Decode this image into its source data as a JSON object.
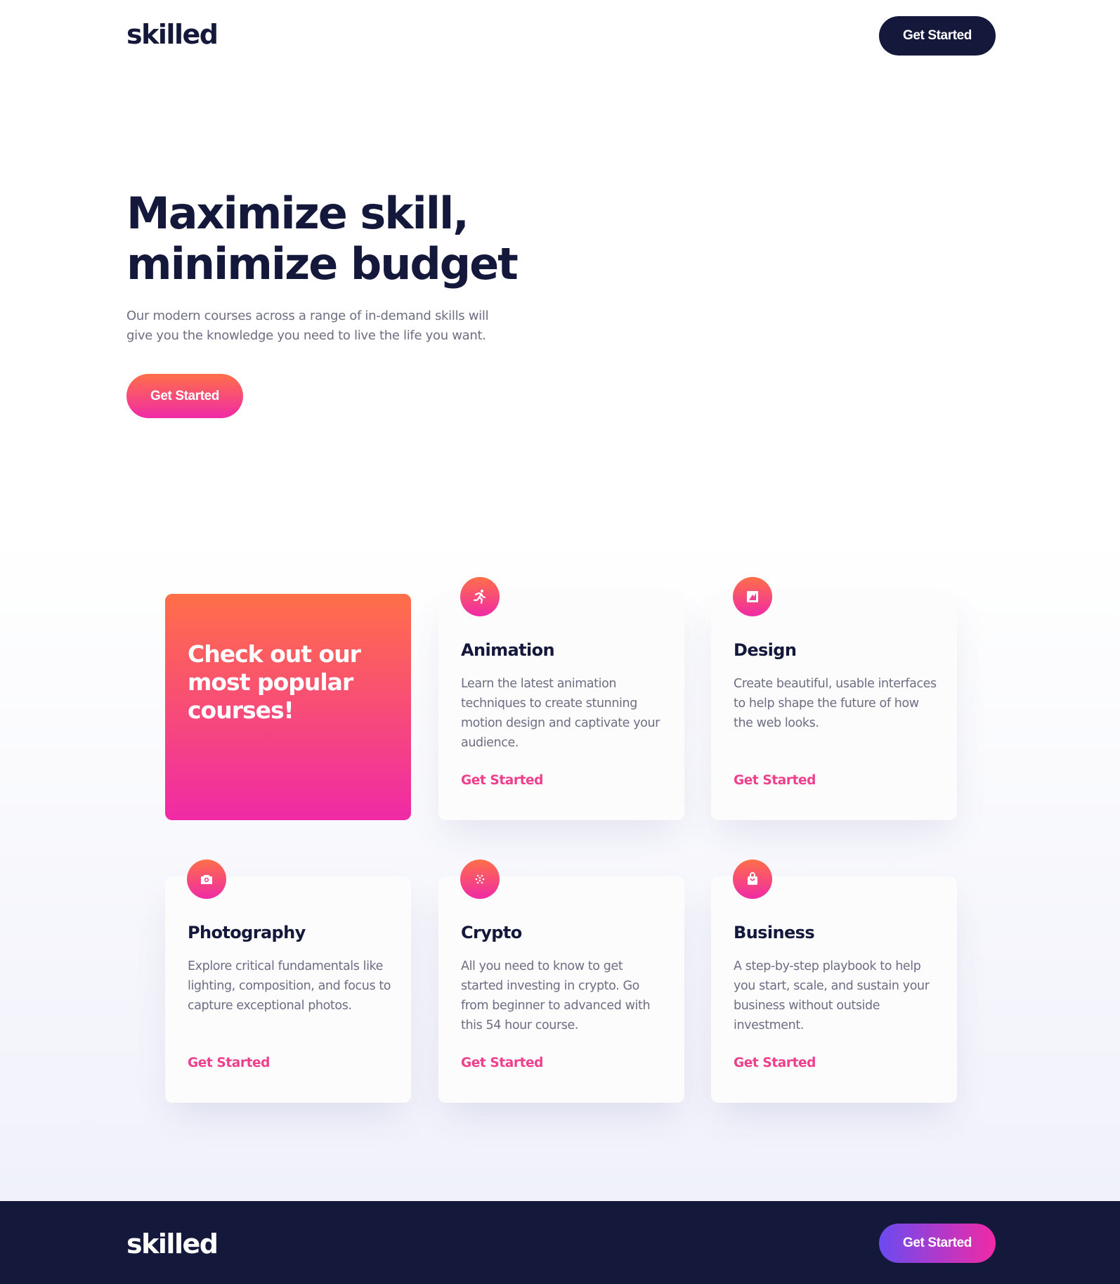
{
  "brand": {
    "logo": "skilled"
  },
  "header": {
    "cta_label": "Get Started"
  },
  "hero": {
    "title_line1": "Maximize skill,",
    "title_line2": "minimize budget",
    "description": "Our modern courses across a range of in-demand skills will give you the knowledge you need to live the life you want.",
    "cta_label": "Get Started"
  },
  "promo": {
    "title": "Check out our most popular courses!"
  },
  "courses": [
    {
      "icon": "running-icon",
      "title": "Animation",
      "description": "Learn the latest animation techniques to create stunning motion design and captivate your audience.",
      "link_label": "Get Started"
    },
    {
      "icon": "design-icon",
      "title": "Design",
      "description": "Create beautiful, usable interfaces to help shape the future of how the web looks.",
      "link_label": "Get Started"
    },
    {
      "icon": "camera-icon",
      "title": "Photography",
      "description": "Explore critical fundamentals like lighting, composition, and focus to capture exceptional photos.",
      "link_label": "Get Started"
    },
    {
      "icon": "crypto-icon",
      "title": "Crypto",
      "description": "All you need to know to get started investing in crypto. Go from beginner to advanced with this 54 hour course.",
      "link_label": "Get Started"
    },
    {
      "icon": "shopping-bag-icon",
      "title": "Business",
      "description": "A step-by-step playbook to help you start, scale, and sustain your business without outside investment.",
      "link_label": "Get Started"
    }
  ],
  "footer": {
    "logo": "skilled",
    "cta_label": "Get Started"
  },
  "colors": {
    "navy": "#14183b",
    "gradient_start": "#ff6f48",
    "gradient_end": "#f02aa6",
    "footer_gradient_start": "#6b4af0",
    "link_pink": "#ef3f8c",
    "body_gray": "#6c6e83"
  }
}
